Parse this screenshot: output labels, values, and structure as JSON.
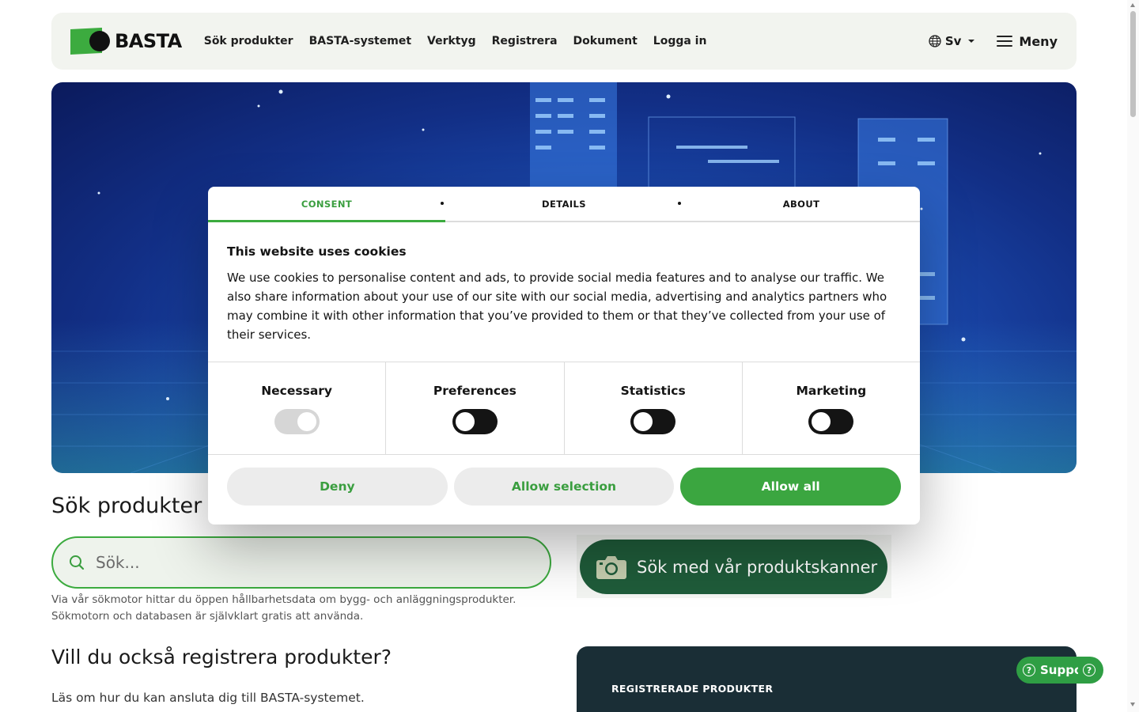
{
  "header": {
    "logo_text": "BASTA",
    "nav": [
      "Sök produkter",
      "BASTA-systemet",
      "Verktyg",
      "Registrera",
      "Dokument",
      "Logga in"
    ],
    "language": "Sv",
    "menu_label": "Meny"
  },
  "search": {
    "title": "Sök produkter i",
    "placeholder": "Sök...",
    "description": "Via vår sökmotor hittar du öppen hållbarhetsdata om bygg- och anläggningsprodukter. Sökmotorn och databasen är självklart gratis att använda.",
    "scanner_label": "Sök med vår produktskanner"
  },
  "register": {
    "title": "Vill du också registrera produkter?",
    "description": "Läs om hur du kan ansluta dig till BASTA-systemet.",
    "stats_label": "REGISTRERADE PRODUKTER"
  },
  "support": {
    "label": "Support"
  },
  "cookie_dialog": {
    "tabs": [
      "CONSENT",
      "DETAILS",
      "ABOUT"
    ],
    "active_tab": "CONSENT",
    "title": "This website uses cookies",
    "text": "We use cookies to personalise content and ads, to provide social media features and to analyse our traffic. We also share information about your use of our site with our social media, advertising and analytics partners who may combine it with other information that you’ve provided to them or that they’ve collected from your use of their services.",
    "categories": [
      {
        "label": "Necessary",
        "enabled": true,
        "disabled": true
      },
      {
        "label": "Preferences",
        "enabled": false,
        "disabled": false
      },
      {
        "label": "Statistics",
        "enabled": false,
        "disabled": false
      },
      {
        "label": "Marketing",
        "enabled": false,
        "disabled": false
      }
    ],
    "buttons": {
      "deny": "Deny",
      "allow_selection": "Allow selection",
      "allow_all": "Allow all"
    }
  },
  "colors": {
    "brand_green": "#3cab3f",
    "scanner_green": "#1f5c3a",
    "stats_bg": "#1a2e36",
    "hero_blue": "#1b4bb0"
  }
}
